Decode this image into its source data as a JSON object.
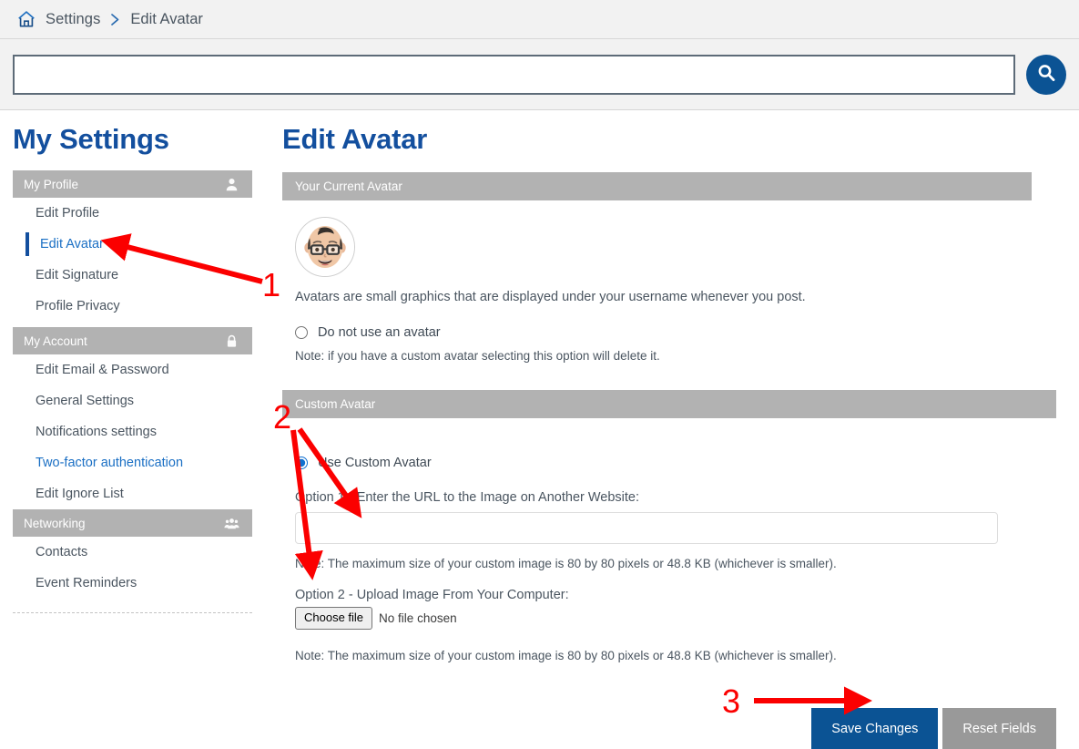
{
  "breadcrumb": {
    "home_icon": "home-icon",
    "items": [
      "Settings",
      "Edit Avatar"
    ],
    "separator": "chevron-right-icon"
  },
  "search": {
    "value": "",
    "placeholder": "",
    "button_icon": "search-icon"
  },
  "sidebar": {
    "title": "My Settings",
    "groups": [
      {
        "label": "My Profile",
        "icon": "user-icon",
        "items": [
          {
            "label": "Edit Profile",
            "active": false,
            "highlight": false
          },
          {
            "label": "Edit Avatar",
            "active": true,
            "highlight": false
          },
          {
            "label": "Edit Signature",
            "active": false,
            "highlight": false
          },
          {
            "label": "Profile Privacy",
            "active": false,
            "highlight": false
          }
        ]
      },
      {
        "label": "My Account",
        "icon": "lock-icon",
        "items": [
          {
            "label": "Edit Email & Password",
            "active": false,
            "highlight": false
          },
          {
            "label": "General Settings",
            "active": false,
            "highlight": false
          },
          {
            "label": "Notifications settings",
            "active": false,
            "highlight": false
          },
          {
            "label": "Two-factor authentication",
            "active": false,
            "highlight": true
          },
          {
            "label": "Edit Ignore List",
            "active": false,
            "highlight": false
          }
        ]
      },
      {
        "label": "Networking",
        "icon": "people-group-icon",
        "items": [
          {
            "label": "Contacts",
            "active": false,
            "highlight": false
          },
          {
            "label": "Event Reminders",
            "active": false,
            "highlight": false
          }
        ]
      }
    ]
  },
  "main": {
    "title": "Edit Avatar",
    "current_avatar": {
      "panel_title": "Your Current Avatar",
      "avatar_alt": "avatar-memoji-face",
      "description": "Avatars are small graphics that are displayed under your username whenever you post.",
      "no_avatar_label": "Do not use an avatar",
      "no_avatar_checked": false,
      "no_avatar_note": "Note: if you have a custom avatar selecting this option will delete it."
    },
    "custom_avatar": {
      "panel_title": "Custom Avatar",
      "use_custom_label": "Use Custom Avatar",
      "use_custom_checked": true,
      "option1_label": "Option 1 - Enter the URL to the Image on Another Website:",
      "option1_value": "",
      "option1_placeholder": "",
      "option1_note": "Note: The maximum size of your custom image is 80 by 80 pixels or 48.8 KB (whichever is smaller).",
      "option2_label": "Option 2 - Upload Image From Your Computer:",
      "choose_file_label": "Choose file",
      "file_status": "No file chosen",
      "option2_note": "Note: The maximum size of your custom image is 80 by 80 pixels or 48.8 KB (whichever is smaller)."
    },
    "buttons": {
      "save_label": "Save Changes",
      "reset_label": "Reset Fields"
    }
  },
  "annotations": {
    "color": "#fb0000",
    "steps": [
      {
        "number": "1",
        "target": "sidebar-item-edit-avatar"
      },
      {
        "number": "2",
        "target": "custom-avatar-url-input-and-file-upload"
      },
      {
        "number": "3",
        "target": "save-changes-button"
      }
    ]
  },
  "colors": {
    "brand_blue": "#134f9e",
    "button_blue": "#0b5394",
    "panel_gray": "#b2b2b2",
    "reset_gray": "#999999",
    "link_blue": "#1a6fc4",
    "annotation_red": "#fb0000"
  }
}
